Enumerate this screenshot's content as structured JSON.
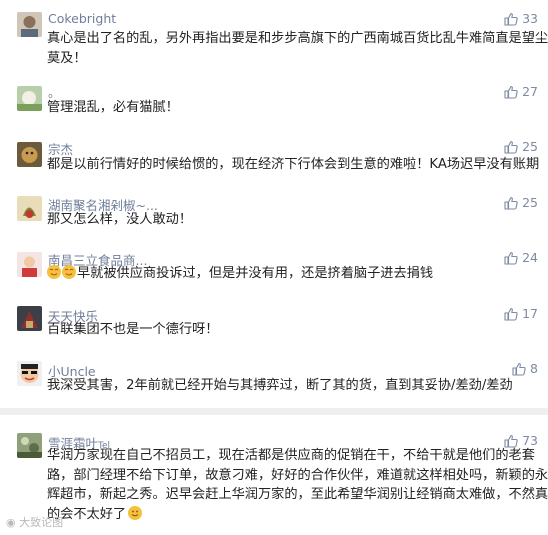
{
  "comments": [
    {
      "name": "Cokebright",
      "text_lines": [
        "真心是出了名的乱，另外再指出要是和步步高旗下的广西南城百货比乱牛难简直是望尘",
        "莫及！"
      ],
      "likes": "33"
    },
    {
      "name": "。",
      "text_lines": [
        "管理混乱，必有猫腻！"
      ],
      "likes": "27"
    },
    {
      "name": "宗杰",
      "text_lines": [
        "都是以前行情好的时候给惯的，现在经济下行体会到生意的难啦！KA场迟早没有账期"
      ],
      "likes": "25"
    },
    {
      "name": "湖南聚名湘剁椒~...",
      "text_lines": [
        "那又怎么样，没人敢动！"
      ],
      "likes": "25"
    },
    {
      "name": "南昌三立食品商...",
      "text_lines": [
        "早就被供应商投诉过，但是并没有用，还是挤着脑子进去捐钱"
      ],
      "likes": "24"
    },
    {
      "name": "天天快乐",
      "text_lines": [
        "百联集团不也是一个德行呀！"
      ],
      "likes": "17"
    },
    {
      "name": "小Uncle",
      "text_lines": [
        "我深受其害，2年前就已经开始与其搏弈过，断了其的货，直到其妥协/差劲/差劲"
      ],
      "likes": "8"
    },
    {
      "name": "雪涯霜叶",
      "name_suffix": "Tel",
      "text_lines": [
        "华润万家现在自己不招员工，现在活都是供应商的促销在干，不给干就是他们的老套",
        "路，部门经理不给下订单，故意刁难，好好的合作伙伴，难道就这样相处吗，新颖的永",
        "辉超市，新起之秀。迟早会赶上华润万家的，至此希望华润别让经销商太难做，不然真",
        "的会不太好了"
      ],
      "likes": "73"
    }
  ],
  "watermark": "大致论图",
  "colors": {
    "name": "#6f7e99",
    "text": "#222222",
    "like": "#7d8aa3",
    "divider": "#efefef"
  }
}
